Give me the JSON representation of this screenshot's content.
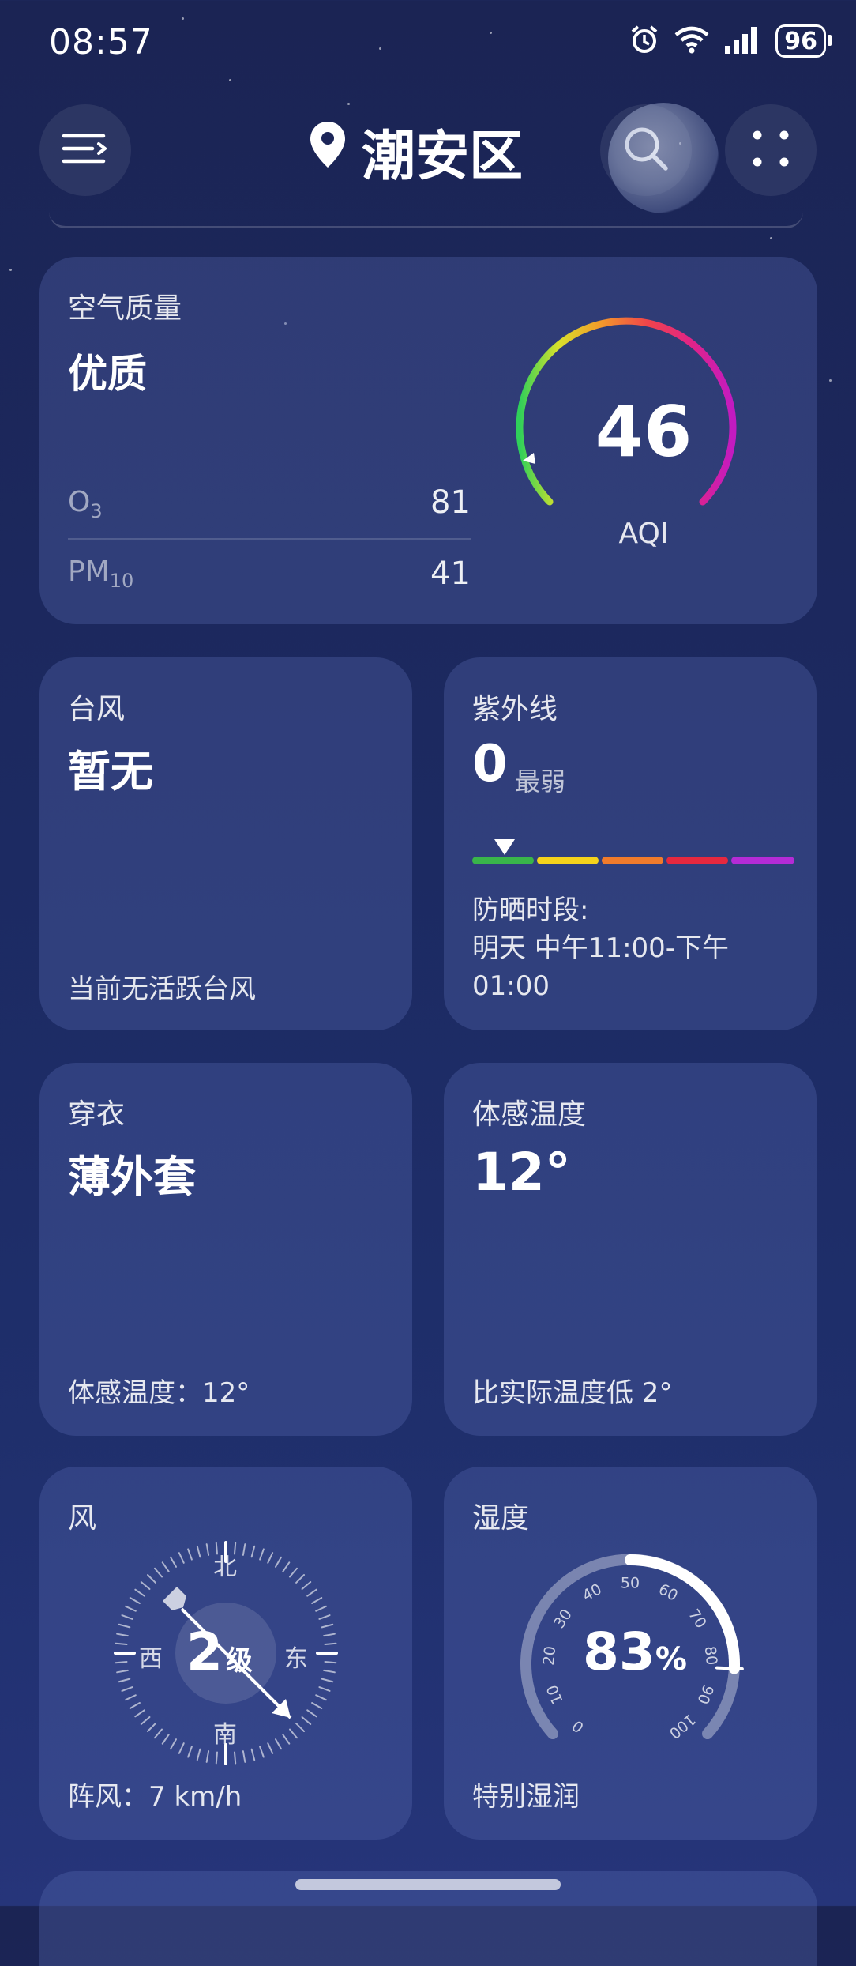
{
  "status_bar": {
    "time": "08:57",
    "battery": "96"
  },
  "header": {
    "location": "潮安区"
  },
  "air_quality": {
    "label": "空气质量",
    "level": "优质",
    "aqi": "46",
    "aqi_label": "AQI",
    "pollutants": [
      {
        "name": "O",
        "sub": "3",
        "value": "81"
      },
      {
        "name": "PM",
        "sub": "10",
        "value": "41"
      }
    ]
  },
  "typhoon": {
    "label": "台风",
    "value": "暂无",
    "footer": "当前无活跃台风"
  },
  "uv": {
    "label": "紫外线",
    "value": "0",
    "level": "最弱",
    "scale_level": 0.1,
    "scale_colors": [
      "#39b54a",
      "#f5d31b",
      "#f07b2b",
      "#e6283f",
      "#b42bd6"
    ],
    "protect_label": "防晒时段:",
    "protect_time_line1": "明天 中午11:00-下午",
    "protect_time_line2": "01:00"
  },
  "clothing": {
    "label": "穿衣",
    "value": "薄外套",
    "footer": "体感温度：12°"
  },
  "feels_like": {
    "label": "体感温度",
    "value": "12°",
    "footer": "比实际温度低 2°"
  },
  "wind": {
    "label": "风",
    "level_num": "2",
    "level_unit": "级",
    "directions": {
      "n": "北",
      "s": "南",
      "e": "东",
      "w": "西"
    },
    "footer": "阵风：7 km/h"
  },
  "humidity": {
    "label": "湿度",
    "value": "83",
    "unit": "%",
    "ticks": [
      "0",
      "10",
      "20",
      "30",
      "40",
      "50",
      "60",
      "70",
      "80",
      "90",
      "100"
    ],
    "footer": "特别湿润"
  }
}
